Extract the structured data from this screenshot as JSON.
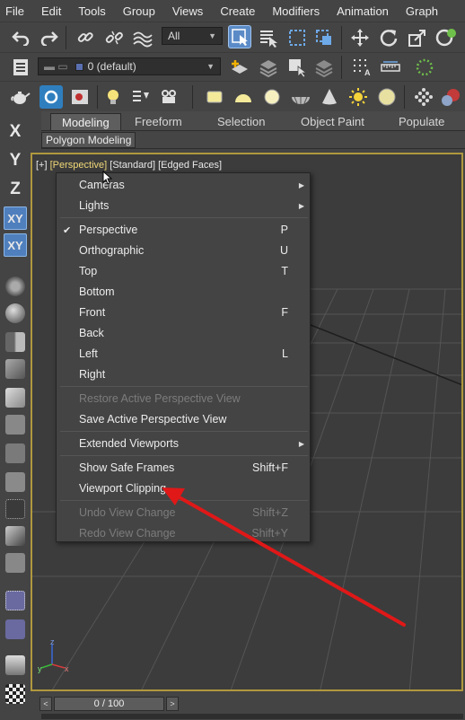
{
  "menubar": {
    "items": [
      "File",
      "Edit",
      "Tools",
      "Group",
      "Views",
      "Create",
      "Modifiers",
      "Animation",
      "Graph"
    ]
  },
  "toolbar": {
    "selection_filter": "All",
    "layer_dropdown": "0 (default)"
  },
  "ribbon": {
    "tabs": [
      "Modeling",
      "Freeform",
      "Selection",
      "Object Paint",
      "Populate"
    ],
    "sub_label": "Polygon Modeling"
  },
  "leftbar": {
    "axis_x": "X",
    "axis_y": "Y",
    "axis_z": "Z",
    "axis_xy": "XY",
    "axis_xy_constrained": "XY"
  },
  "viewport": {
    "label_plus": "[+]",
    "label_view": "[Perspective]",
    "label_shading": "[Standard]",
    "label_edges": "[Edged Faces]",
    "gizmo_z": "z",
    "gizmo_x": "x",
    "gizmo_y": "y"
  },
  "context_menu": {
    "items": [
      {
        "label": "Cameras",
        "shortcut": "",
        "submenu": true,
        "checked": false,
        "disabled": false
      },
      {
        "label": "Lights",
        "shortcut": "",
        "submenu": true,
        "checked": false,
        "disabled": false
      },
      {
        "label": "Perspective",
        "shortcut": "P",
        "submenu": false,
        "checked": true,
        "disabled": false
      },
      {
        "label": "Orthographic",
        "shortcut": "U",
        "submenu": false,
        "checked": false,
        "disabled": false
      },
      {
        "label": "Top",
        "shortcut": "T",
        "submenu": false,
        "checked": false,
        "disabled": false
      },
      {
        "label": "Bottom",
        "shortcut": "",
        "submenu": false,
        "checked": false,
        "disabled": false
      },
      {
        "label": "Front",
        "shortcut": "F",
        "submenu": false,
        "checked": false,
        "disabled": false
      },
      {
        "label": "Back",
        "shortcut": "",
        "submenu": false,
        "checked": false,
        "disabled": false
      },
      {
        "label": "Left",
        "shortcut": "L",
        "submenu": false,
        "checked": false,
        "disabled": false
      },
      {
        "label": "Right",
        "shortcut": "",
        "submenu": false,
        "checked": false,
        "disabled": false
      },
      {
        "label": "Restore Active Perspective View",
        "shortcut": "",
        "submenu": false,
        "checked": false,
        "disabled": true
      },
      {
        "label": "Save Active Perspective View",
        "shortcut": "",
        "submenu": false,
        "checked": false,
        "disabled": false
      },
      {
        "label": "Extended Viewports",
        "shortcut": "",
        "submenu": true,
        "checked": false,
        "disabled": false
      },
      {
        "label": "Show Safe Frames",
        "shortcut": "Shift+F",
        "submenu": false,
        "checked": false,
        "disabled": false
      },
      {
        "label": "Viewport Clipping",
        "shortcut": "",
        "submenu": false,
        "checked": false,
        "disabled": false
      },
      {
        "label": "Undo View Change",
        "shortcut": "Shift+Z",
        "submenu": false,
        "checked": false,
        "disabled": true
      },
      {
        "label": "Redo View Change",
        "shortcut": "Shift+Y",
        "submenu": false,
        "checked": false,
        "disabled": true
      }
    ],
    "check_glyph": "✔",
    "submenu_glyph": "▶"
  },
  "timeslider": {
    "prev": "<",
    "next": ">",
    "frame_readout": "0 / 100"
  },
  "colors": {
    "annotation_arrow": "#e01818",
    "viewport_border": "#b0983e",
    "selected_button": "#5b8bc7"
  }
}
